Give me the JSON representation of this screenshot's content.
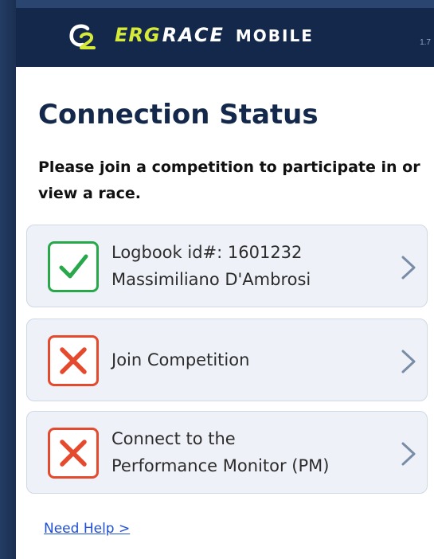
{
  "header": {
    "logo_name": "c2-logo",
    "brand_erg": "ERG",
    "brand_race": "RACE",
    "brand_mobile": "MOBILE",
    "version": "1.7",
    "colors": {
      "background": "#13284a",
      "accent": "#d6ea3a"
    }
  },
  "page": {
    "title": "Connection Status",
    "intro": "Please join a competition to participate in or view a race."
  },
  "status_items": [
    {
      "status": "connected",
      "icon": "check-icon",
      "line1": "Logbook id#: 1601232",
      "line2": "Massimiliano D'Ambrosi",
      "color": "#28a84a"
    },
    {
      "status": "not-connected",
      "icon": "x-icon",
      "line1": "Join Competition",
      "color": "#e44a2d"
    },
    {
      "status": "not-connected",
      "icon": "x-icon",
      "line1": "Connect to the",
      "line2": "Performance Monitor (PM)",
      "color": "#e44a2d"
    }
  ],
  "help": {
    "label": "Need Help >"
  }
}
